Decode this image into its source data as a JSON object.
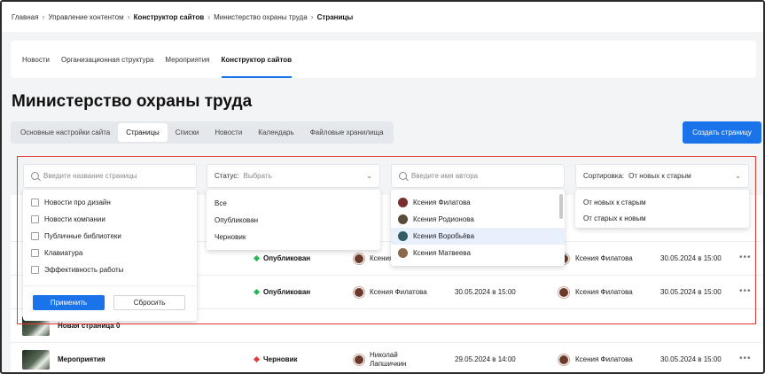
{
  "breadcrumb": {
    "items": [
      "Главная",
      "Управление контентом",
      "Конструктор сайтов",
      "Министерство охраны труда",
      "Страницы"
    ],
    "strong": [
      false,
      false,
      true,
      false,
      true
    ]
  },
  "top_tabs": [
    "Новости",
    "Организационная структура",
    "Мероприятия",
    "Конструктор сайтов"
  ],
  "top_tabs_active": 3,
  "page_title": "Министерство охраны труда",
  "sub_tabs": [
    "Основные настройки сайта",
    "Страницы",
    "Списки",
    "Новости",
    "Календарь",
    "Файловые хранилища"
  ],
  "sub_tabs_active": 1,
  "create_button": "Создать страницу",
  "filters": {
    "page_search_placeholder": "Введите название страницы",
    "status_label": "Статус:",
    "status_value": "Выбрать",
    "author_search_placeholder": "Введите имя автора",
    "sort_label": "Сортировка:",
    "sort_value": "От новых к старым"
  },
  "page_dropdown": {
    "options": [
      "Новости про дизайн",
      "Новости компании",
      "Публичные библиотеки",
      "Клавиатура",
      "Эффективность работы"
    ],
    "apply": "Применить",
    "reset": "Сбросить"
  },
  "status_dropdown": {
    "options": [
      "Все",
      "Опубликован",
      "Черновик"
    ]
  },
  "author_dropdown": {
    "options": [
      "Ксения Филатова",
      "Ксения Родионова",
      "Ксения Воробьёва",
      "Ксения Матвеева"
    ],
    "hovered": 2
  },
  "sort_dropdown": {
    "options": [
      "От новых к старым",
      "От старых к новым"
    ]
  },
  "rows": [
    {
      "name": "",
      "status": "Опубликован",
      "author": "Ксения",
      "created": "",
      "editor": "Ксения Филатова",
      "edited": "30.05.2024 в 15:00",
      "status_color": "#1db954"
    },
    {
      "name": "",
      "status": "Опубликован",
      "author": "Ксения Филатова",
      "created": "30.05.2024 в 15:00",
      "editor": "Ксения Филатова",
      "edited": "30.05.2024 в 15:00",
      "status_color": "#1db954"
    },
    {
      "name": "Новая страница 0",
      "status": "",
      "author": "",
      "created": "",
      "editor": "",
      "edited": "",
      "status_color": "#1db954"
    },
    {
      "name": "Мероприятия",
      "status": "Черновик",
      "author": "Николай Лапшичкин",
      "created": "29.05.2024 в 14:00",
      "editor": "Ксения Филатова",
      "edited": "30.05.2024 в 15:00",
      "status_color": "#e53935"
    }
  ],
  "colors": {
    "accent": "#1a73e8",
    "published": "#1db954",
    "draft": "#e53935",
    "highlight_outline": "#e53935"
  }
}
